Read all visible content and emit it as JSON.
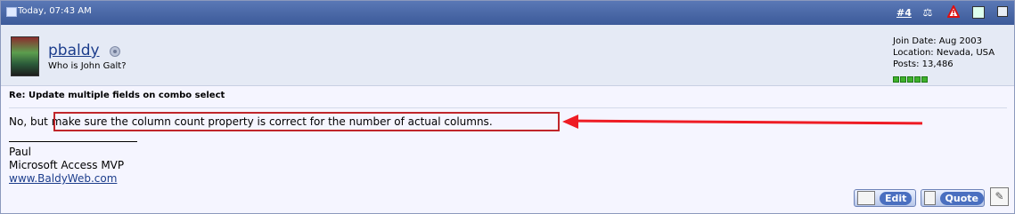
{
  "post": {
    "date": "Today, 07:43 AM",
    "post_number": "#4",
    "username": "pbaldy",
    "user_title": "Who is John Galt?",
    "join_date": "Join Date: Aug 2003",
    "location": "Location: Nevada, USA",
    "posts": "Posts: 13,486",
    "title": "Re: Update multiple fields on combo select",
    "message_prefix": "No, but ",
    "message_highlight": "make sure the column count property is correct for the number of actual columns.",
    "signature": {
      "name": "Paul",
      "role": "Microsoft Access MVP",
      "link": "www.BaldyWeb.com"
    }
  },
  "buttons": {
    "edit": "Edit",
    "quote": "Quote"
  },
  "icons": {
    "header": [
      "document-icon",
      "scale-icon",
      "warning-icon",
      "computer-icon",
      "checkbox-icon"
    ],
    "online": "online-status-icon"
  },
  "colors": {
    "header_bg": "#3c5a99",
    "annotation": "#ee1c24",
    "reputation": "#3fb02b"
  }
}
